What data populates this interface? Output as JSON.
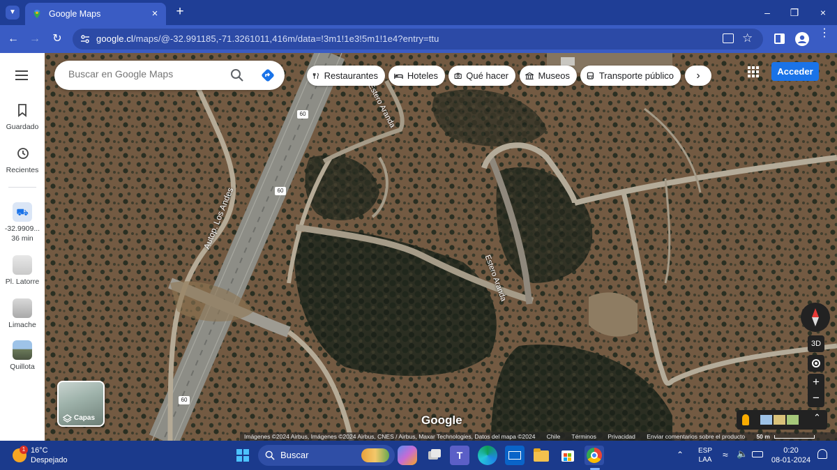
{
  "browser": {
    "tab_title": "Google Maps",
    "new_tab": "+",
    "url_domain": "google.cl",
    "url_path": "/maps/@-32.991185,-71.3261011,416m/data=!3m1!1e3!5m1!1e4?entry=ttu"
  },
  "search": {
    "placeholder": "Buscar en Google Maps"
  },
  "chips": [
    {
      "label": "Restaurantes",
      "icon": "fork-knife-icon"
    },
    {
      "label": "Hoteles",
      "icon": "bed-icon"
    },
    {
      "label": "Qué hacer",
      "icon": "camera-icon"
    },
    {
      "label": "Museos",
      "icon": "museum-icon"
    },
    {
      "label": "Transporte público",
      "icon": "bus-icon"
    }
  ],
  "account": {
    "signin_label": "Acceder"
  },
  "sidebar": {
    "items": [
      {
        "label": "Guardado",
        "icon": "bookmark-icon"
      },
      {
        "label": "Recientes",
        "icon": "history-icon"
      },
      {
        "label": "-32.9909...",
        "sub": "36 min",
        "icon": "car-icon"
      },
      {
        "label": "Pl. Latorre",
        "icon": "place-thumb"
      },
      {
        "label": "Limache",
        "icon": "place-thumb"
      },
      {
        "label": "Quillota",
        "icon": "place-thumb"
      }
    ]
  },
  "map": {
    "road_labels": [
      "Autop. Los Andes",
      "Estero Aranda",
      "Estero Aranda"
    ],
    "route_shields": [
      "60",
      "60",
      "60"
    ],
    "layers_label": "Capas",
    "logo": "Google",
    "btn_3d": "3D",
    "zoom_in": "+",
    "zoom_out": "−",
    "attribution": {
      "imagery": "Imágenes ©2024 Airbus, Imágenes ©2024 Airbus, CNES / Airbus, Maxar Technologies, Datos del mapa ©2024",
      "country": "Chile",
      "terms": "Términos",
      "privacy": "Privacidad",
      "feedback": "Enviar comentarios sobre el producto",
      "scale": "50 m"
    }
  },
  "taskbar": {
    "weather_temp": "16°C",
    "weather_desc": "Despejado",
    "weather_badge": "1",
    "search_label": "Buscar",
    "lang_top": "ESP",
    "lang_bottom": "LAA",
    "time": "0:20",
    "date": "08-01-2024"
  },
  "colors": {
    "accent": "#1a73e8",
    "browser_frame": "#1f3e96",
    "map_ground": "#6b5540"
  }
}
